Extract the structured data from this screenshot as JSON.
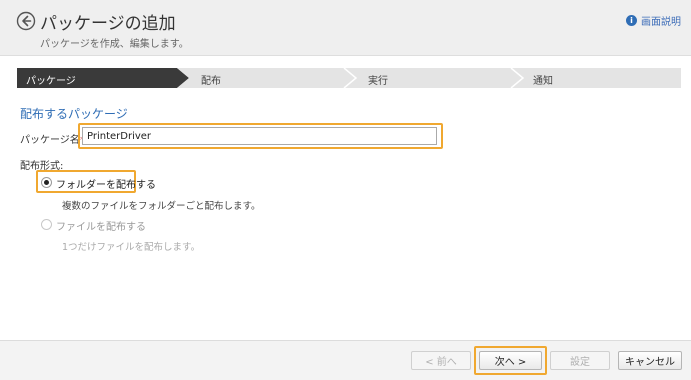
{
  "header": {
    "title": "パッケージの追加",
    "subtitle": "パッケージを作成、編集します。",
    "help_label": "画面説明",
    "back_icon": "back-arrow-icon",
    "help_icon": "info-icon"
  },
  "steps": [
    {
      "label": "パッケージ",
      "active": true
    },
    {
      "label": "配布",
      "active": false
    },
    {
      "label": "実行",
      "active": false
    },
    {
      "label": "通知",
      "active": false
    }
  ],
  "form": {
    "section_title": "配布するパッケージ",
    "package_name_label": "パッケージ名",
    "required_mark": "*:",
    "package_name_value": "PrinterDriver",
    "format_label": "配布形式:",
    "options": [
      {
        "label": "フォルダーを配布する",
        "description": "複数のファイルをフォルダーごと配布します。",
        "selected": true,
        "enabled": true
      },
      {
        "label": "ファイルを配布する",
        "description": "1つだけファイルを配布します。",
        "selected": false,
        "enabled": false
      }
    ]
  },
  "footer": {
    "prev_label": "< 前へ",
    "next_label": "次へ >",
    "settings_label": "設定",
    "cancel_label": "キャンセル"
  },
  "colors": {
    "accent": "#2f6db5",
    "highlight": "#f0a830",
    "active_step": "#3a3a3a",
    "inactive_step": "#e4e4e4"
  }
}
